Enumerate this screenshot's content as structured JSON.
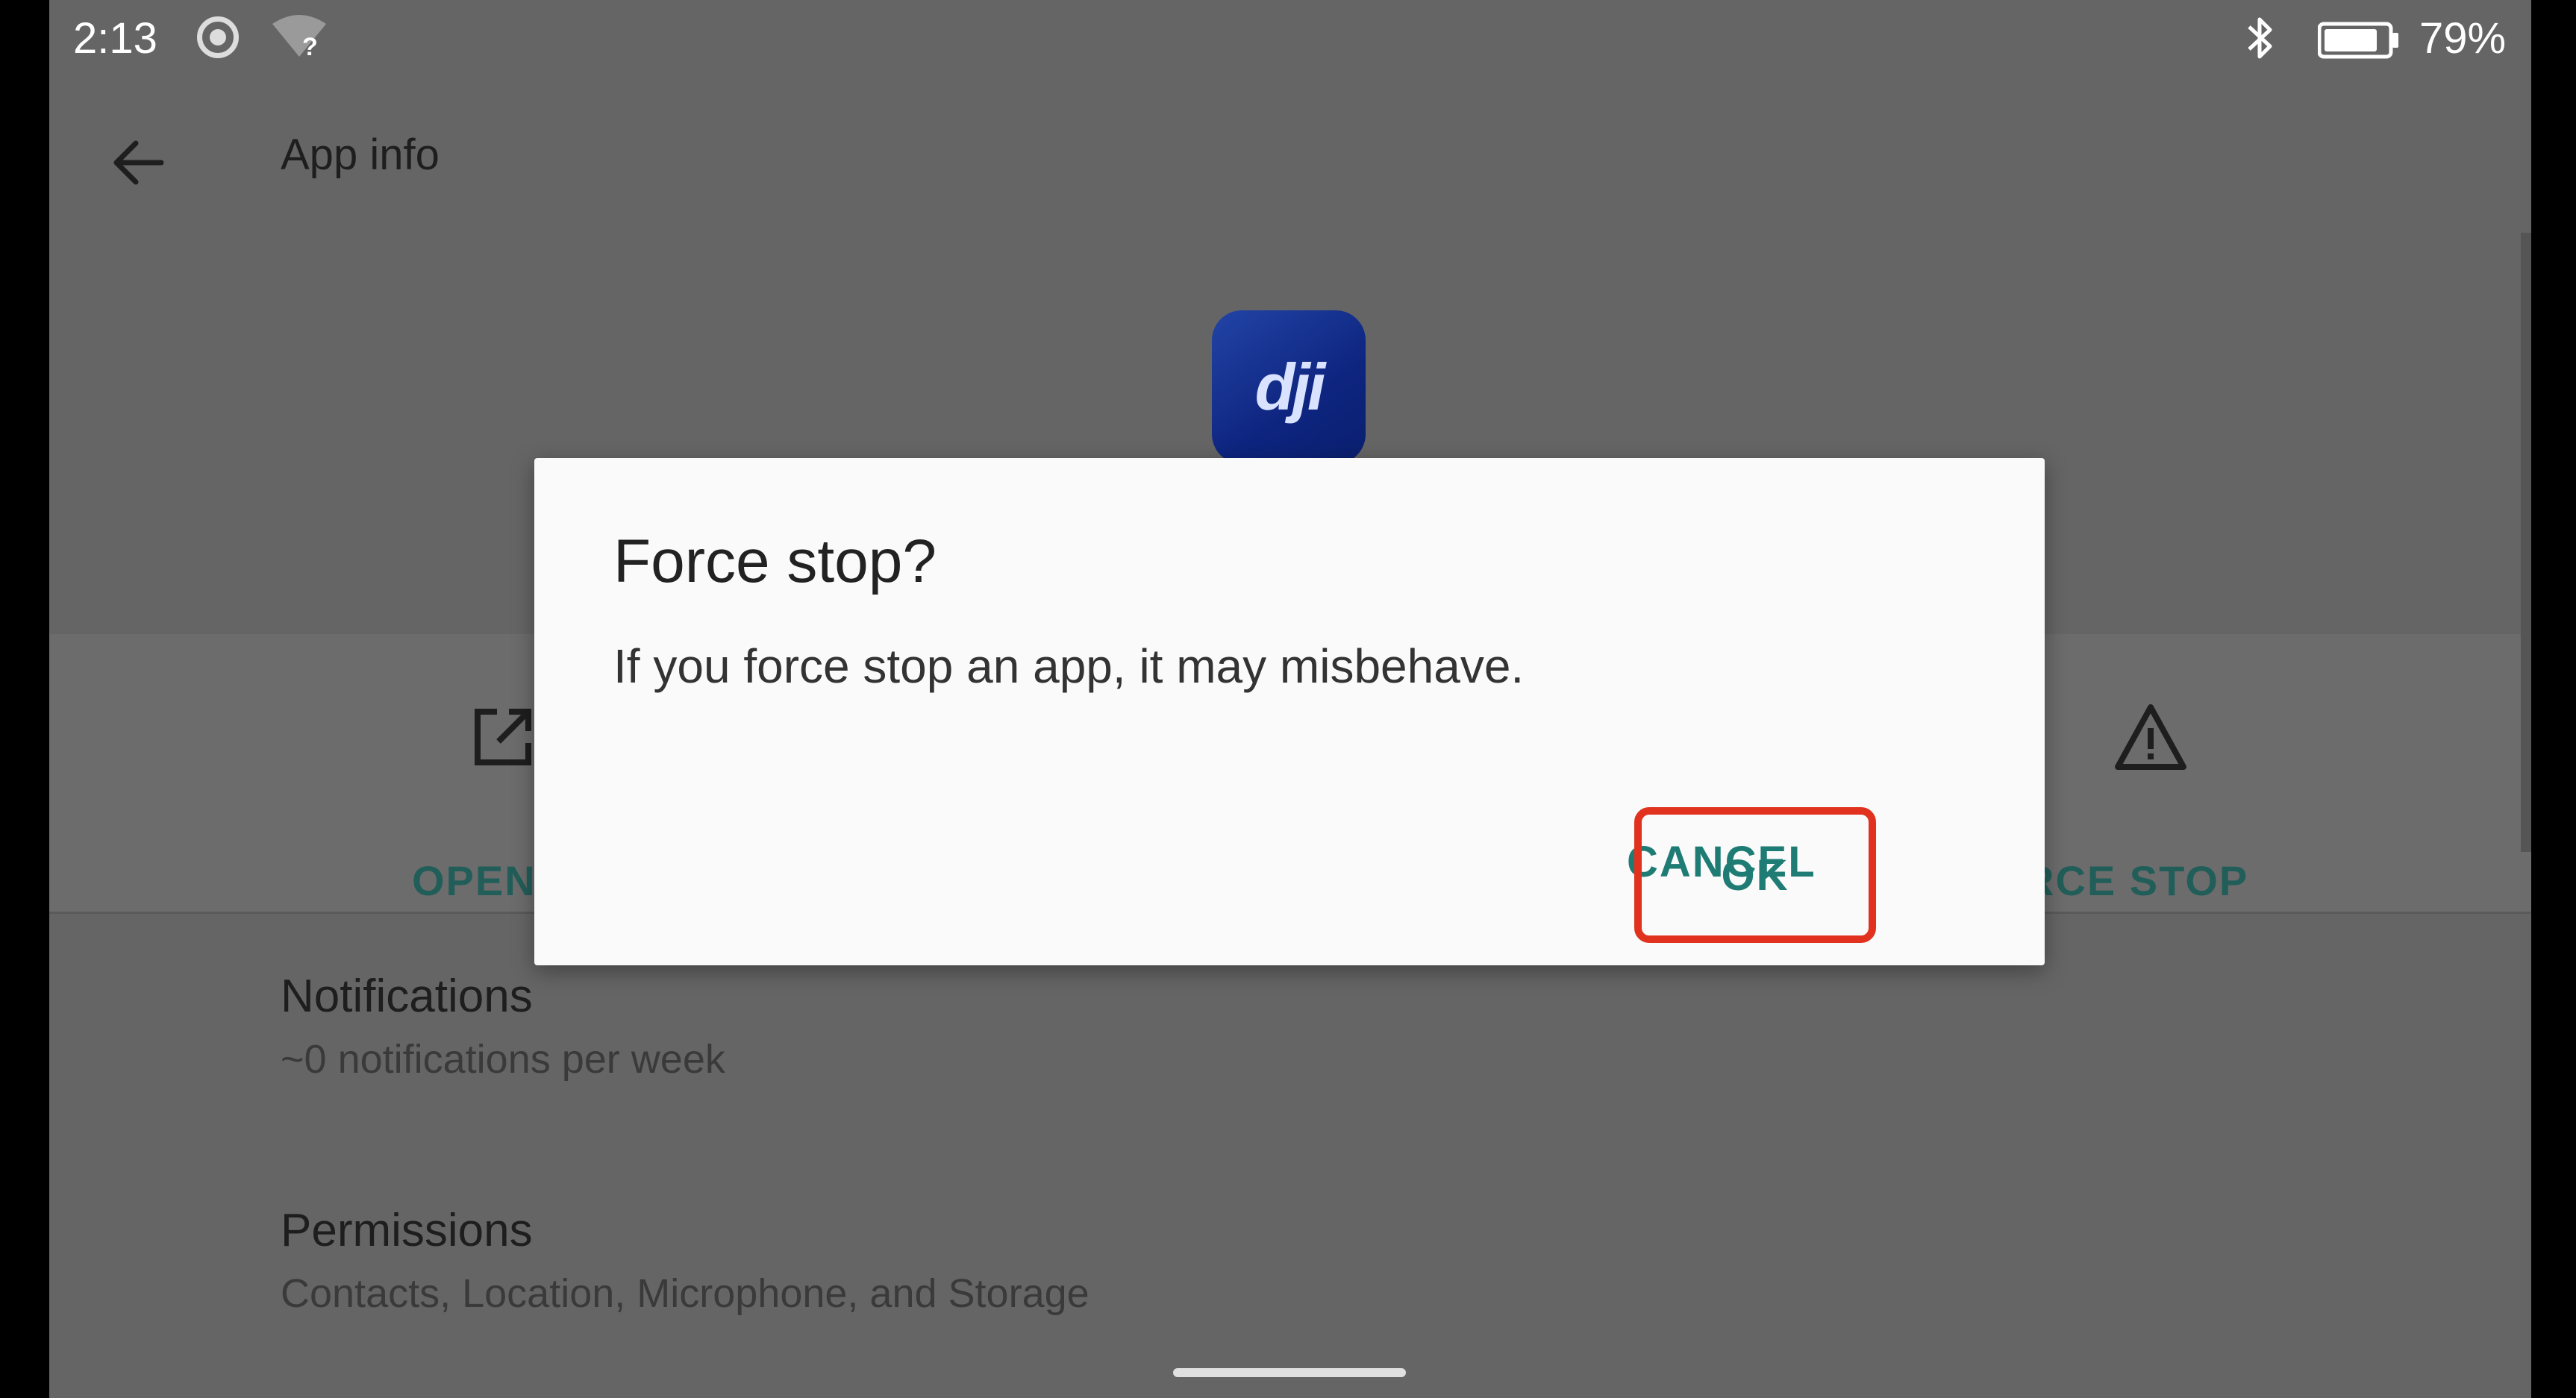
{
  "status_bar": {
    "time": "2:13",
    "battery": "79%",
    "icons": [
      "screen-record-icon",
      "wifi-unknown-icon",
      "bluetooth-icon",
      "battery-icon"
    ]
  },
  "app_bar": {
    "back_icon": "back-arrow-icon",
    "title": "App info"
  },
  "app": {
    "icon_text": "dji"
  },
  "actions": {
    "open_label": "OPEN",
    "force_stop_label": "RCE STOP"
  },
  "settings": {
    "notifications": {
      "title": "Notifications",
      "subtitle": "~0 notifications per week"
    },
    "permissions": {
      "title": "Permissions",
      "subtitle": "Contacts, Location, Microphone, and Storage"
    }
  },
  "dialog": {
    "title": "Force stop?",
    "message": "If you force stop an app, it may misbehave.",
    "cancel_label": "CANCEL",
    "ok_label": "OK"
  },
  "colors": {
    "accent": "#1e7c74",
    "highlight": "#e0321e",
    "dialog_bg": "#fafafa",
    "scrim": "#656565"
  }
}
